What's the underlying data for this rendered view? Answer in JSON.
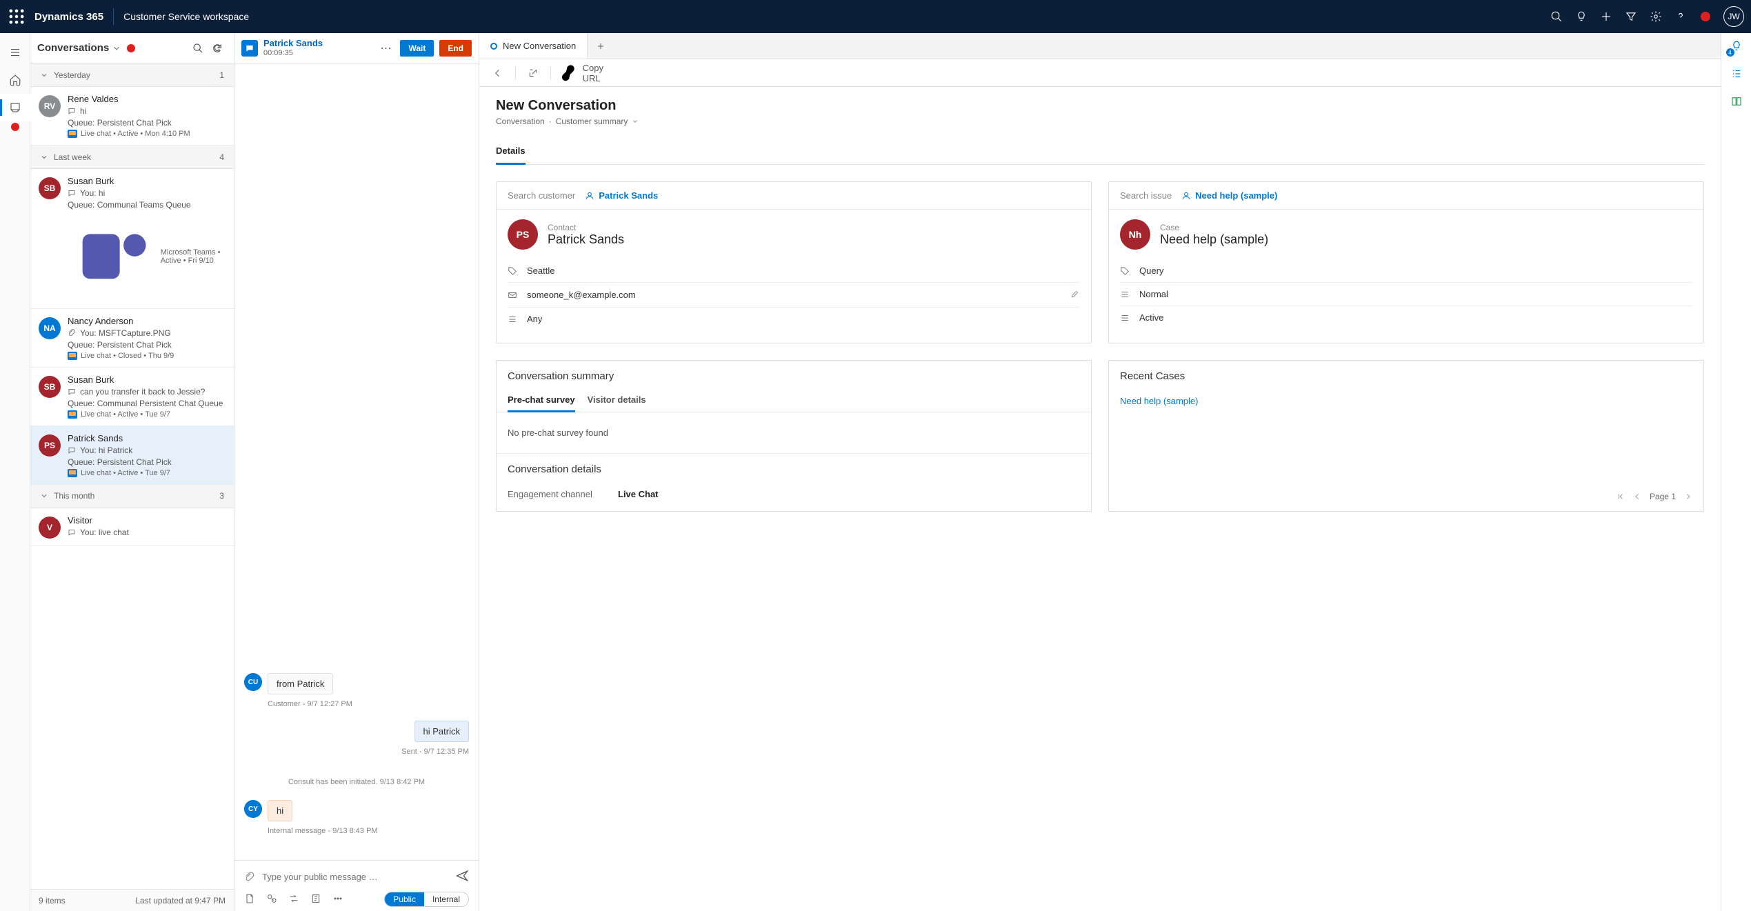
{
  "topbar": {
    "brand": "Dynamics 365",
    "workspace": "Customer Service workspace",
    "avatar_initials": "JW"
  },
  "convo_panel": {
    "title": "Conversations",
    "groups": [
      {
        "label": "Yesterday",
        "count": "1"
      },
      {
        "label": "Last week",
        "count": "4"
      },
      {
        "label": "This month",
        "count": "3"
      }
    ],
    "items": {
      "rv": {
        "name": "Rene Valdes",
        "initials": "RV",
        "avatar_bg": "#8a8d90",
        "preview": "hi",
        "queue": "Queue: Persistent Chat Pick",
        "meta": "Live chat  •  Active  •  Mon 4:10 PM"
      },
      "sb1": {
        "name": "Susan Burk",
        "initials": "SB",
        "avatar_bg": "#a4262c",
        "preview": "You: hi",
        "queue": "Queue: Communal Teams Queue",
        "meta": "Microsoft Teams  •  Active  •  Fri 9/10",
        "teams_icon": true
      },
      "na": {
        "name": "Nancy Anderson",
        "initials": "NA",
        "avatar_bg": "#0078d4",
        "preview": "You: MSFTCapture.PNG",
        "queue": "Queue: Persistent Chat Pick",
        "meta": "Live chat  •  Closed  •  Thu 9/9",
        "attach_icon": true
      },
      "sb2": {
        "name": "Susan Burk",
        "initials": "SB",
        "avatar_bg": "#a4262c",
        "preview": "can you transfer it back to Jessie?",
        "queue": "Queue: Communal Persistent Chat Queue",
        "meta": "Live chat  •  Active  •  Tue 9/7"
      },
      "ps": {
        "name": "Patrick Sands",
        "initials": "PS",
        "avatar_bg": "#a4262c",
        "preview": "You: hi Patrick",
        "queue": "Queue: Persistent Chat Pick",
        "meta": "Live chat  •  Active  •  Tue 9/7"
      },
      "v": {
        "name": "Visitor",
        "initials": "V",
        "avatar_bg": "#a4262c",
        "preview": "You: live chat"
      }
    },
    "footer_left": "9 items",
    "footer_right": "Last updated at 9:47 PM"
  },
  "chat": {
    "header_name": "Patrick Sands",
    "header_time": "00:09:35",
    "btn_wait": "Wait",
    "btn_end": "End",
    "msgs": {
      "cu": {
        "initials": "CU",
        "bg": "#0078d4",
        "text": "from Patrick",
        "meta": "Customer - 9/7 12:27 PM"
      },
      "sent": {
        "text": "hi Patrick",
        "meta": "Sent - 9/7 12:35 PM"
      },
      "sys": "Consult has been initiated. 9/13 8:42 PM",
      "cy": {
        "initials": "CY",
        "bg": "#0078d4",
        "text": "hi",
        "meta": "Internal message - 9/13 8:43 PM"
      }
    },
    "compose_placeholder": "Type your public message …",
    "seg_public": "Public",
    "seg_internal": "Internal"
  },
  "right": {
    "tab_label": "New Conversation",
    "copy_url": "Copy URL",
    "title": "New Conversation",
    "crumb1": "Conversation",
    "crumb2": "Customer summary",
    "section_details": "Details",
    "customer_card": {
      "search": "Search customer",
      "link": "Patrick Sands",
      "entity_label": "Contact",
      "entity_name": "Patrick Sands",
      "entity_initials": "PS",
      "fields": {
        "city": "Seattle",
        "email": "someone_k@example.com",
        "pref": "Any"
      }
    },
    "issue_card": {
      "search": "Search issue",
      "link": "Need help (sample)",
      "entity_label": "Case",
      "entity_name": "Need help (sample)",
      "entity_initials": "Nh",
      "fields": {
        "type": "Query",
        "priority": "Normal",
        "status": "Active"
      }
    },
    "summary_card": {
      "title": "Conversation summary",
      "tab1": "Pre-chat survey",
      "tab2": "Visitor details",
      "empty": "No pre-chat survey found",
      "details_heading": "Conversation details",
      "kv_k": "Engagement channel",
      "kv_v": "Live Chat"
    },
    "recent_card": {
      "title": "Recent Cases",
      "item1": "Need help (sample)",
      "pager": "Page 1"
    }
  },
  "tool_badge": "4"
}
